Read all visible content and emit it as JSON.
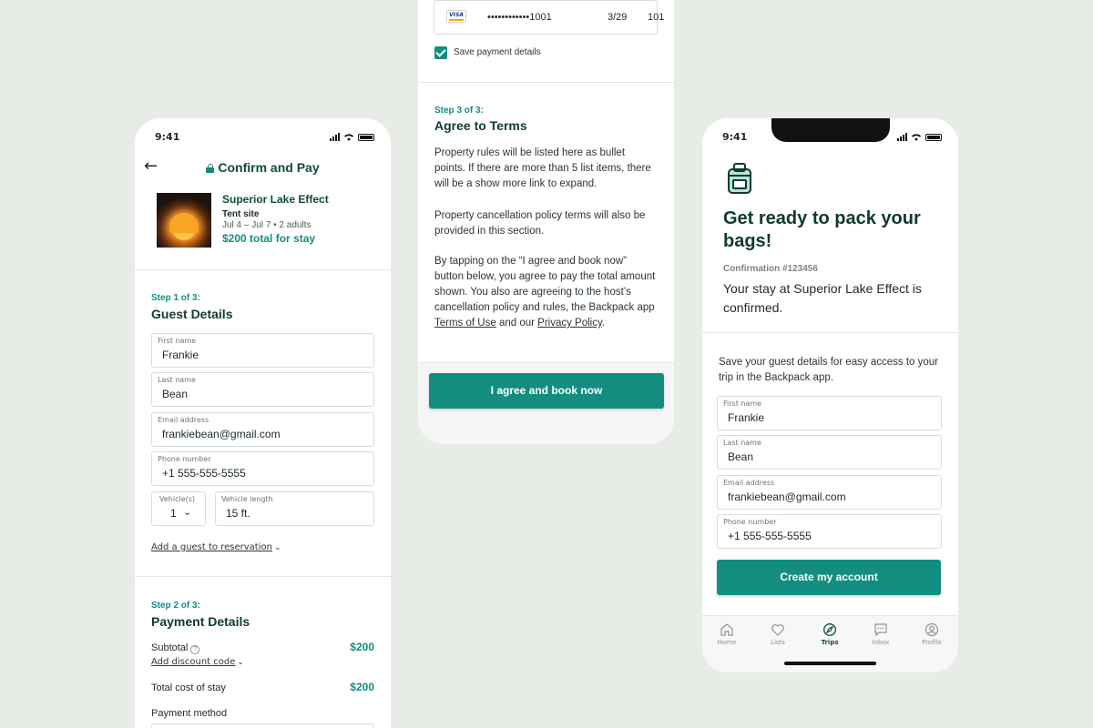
{
  "status": {
    "time": "9:41"
  },
  "screen1": {
    "nav_title": "Confirm and Pay",
    "property": {
      "name": "Superior Lake Effect",
      "type": "Tent site",
      "dates": "Jul 4 – Jul 7 • 2 adults",
      "total": "$200 total for stay"
    },
    "step1": {
      "label": "Step 1 of 3:",
      "title": "Guest Details",
      "fields": [
        {
          "label": "First name",
          "value": "Frankie"
        },
        {
          "label": "Last name",
          "value": "Bean"
        },
        {
          "label": "Email address",
          "value": "frankiebean@gmail.com"
        },
        {
          "label": "Phone number",
          "value": "+1 555-555-5555"
        }
      ],
      "vehicles_label": "Vehicle(s)",
      "vehicles_value": "1",
      "vehicle_length_label": "Vehicle length",
      "vehicle_length_value": "15 ft.",
      "add_guest": "Add a guest to reservation"
    },
    "step2": {
      "label": "Step 2 of 3:",
      "title": "Payment Details",
      "subtotal_label": "Subtotal",
      "subtotal_value": "$200",
      "discount_link": "Add discount code",
      "total_label": "Total cost of stay",
      "total_value": "$200",
      "payment_method_label": "Payment method"
    }
  },
  "screen2": {
    "card": {
      "brand": "VISA",
      "number": "••••••••••••1001",
      "expiry": "3/29",
      "cvv": "101"
    },
    "save_payment": "Save payment details",
    "step3": {
      "label": "Step 3 of 3:",
      "title": "Agree to Terms",
      "para1": "Property rules will be listed here as bullet points. If there are more than 5 list items, there will be a show more link to expand.",
      "para2": "Property cancellation policy terms will also be provided in this section.",
      "para3_prefix": "By tapping on the “I agree and book now” button below, you agree to pay the total amount shown. You also are agreeing to the host’s cancellation policy and rules, the Backpack app ",
      "terms_link": "Terms of Use",
      "para3_mid": " and our ",
      "privacy_link": "Privacy Policy",
      "para3_suffix": "."
    },
    "agree_button": "I agree and book now"
  },
  "screen3": {
    "title": "Get ready to pack your bags!",
    "confirmation": "Confirmation #123456",
    "confirmed_text": "Your stay at Superior Lake Effect is confirmed.",
    "save_prompt": "Save your guest details for easy access to your trip in the Backpack app.",
    "fields": [
      {
        "label": "First name",
        "value": "Frankie"
      },
      {
        "label": "Last name",
        "value": "Bean"
      },
      {
        "label": "Email address",
        "value": "frankiebean@gmail.com"
      },
      {
        "label": "Phone number",
        "value": "+1 555-555-5555"
      }
    ],
    "create_button": "Create my account",
    "tabs": [
      {
        "label": "Home",
        "icon": "home-icon"
      },
      {
        "label": "Lists",
        "icon": "heart-icon"
      },
      {
        "label": "Trips",
        "icon": "compass-icon",
        "active": true
      },
      {
        "label": "Inbox",
        "icon": "chat-icon"
      },
      {
        "label": "Profile",
        "icon": "profile-icon"
      }
    ]
  },
  "colors": {
    "accent": "#138d80",
    "heading": "#0f3a32",
    "background": "#e8ece6"
  }
}
